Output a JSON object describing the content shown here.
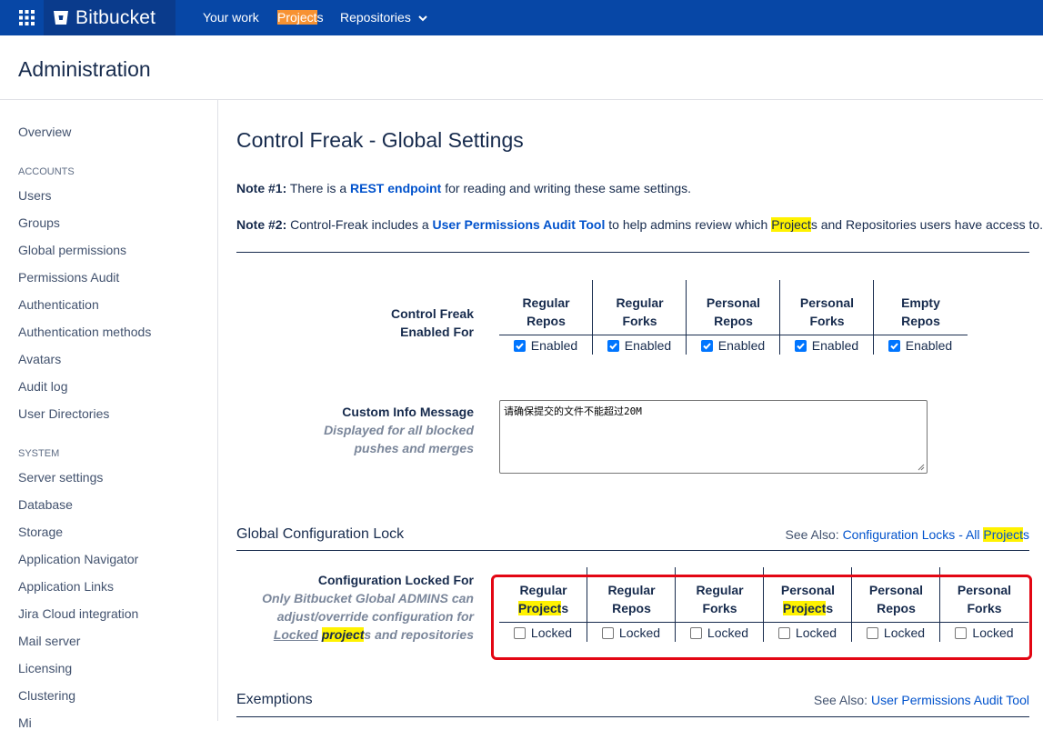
{
  "topbar": {
    "brand": "Bitbucket",
    "nav": [
      {
        "label": "Your work"
      },
      {
        "label_hl": "Project",
        "label_rest": "s"
      },
      {
        "label": "Repositories"
      }
    ]
  },
  "admin_title": "Administration",
  "sidebar": {
    "overview": "Overview",
    "accounts_heading": "ACCOUNTS",
    "accounts": [
      "Users",
      "Groups",
      "Global permissions",
      "Permissions Audit",
      "Authentication",
      "Authentication methods",
      "Avatars",
      "Audit log",
      "User Directories"
    ],
    "system_heading": "SYSTEM",
    "system": [
      "Server settings",
      "Database",
      "Storage",
      "Application Navigator",
      "Application Links",
      "Jira Cloud integration",
      "Mail server",
      "Licensing",
      "Clustering",
      "Mi"
    ]
  },
  "main": {
    "title": "Control Freak - Global Settings",
    "note1": {
      "label": "Note #1:",
      "pre": " There is a ",
      "link": "REST endpoint",
      "post": " for reading and writing these same settings."
    },
    "note2": {
      "label": "Note #2:",
      "pre": " Control-Freak includes a ",
      "link": "User Permissions Audit Tool",
      "mid": " to help admins review which ",
      "hl": "Project",
      "post": "s and Repositories users have access to."
    },
    "enabled_for": {
      "label_line1": "Control Freak",
      "label_line2": "Enabled For",
      "columns": [
        {
          "l1": "Regular",
          "l2": "Repos",
          "check": "Enabled",
          "checked": true
        },
        {
          "l1": "Regular",
          "l2": "Forks",
          "check": "Enabled",
          "checked": true
        },
        {
          "l1": "Personal",
          "l2": "Repos",
          "check": "Enabled",
          "checked": true
        },
        {
          "l1": "Personal",
          "l2": "Forks",
          "check": "Enabled",
          "checked": true
        },
        {
          "l1": "Empty",
          "l2": "Repos",
          "check": "Enabled",
          "checked": true
        }
      ]
    },
    "custom_info": {
      "label": "Custom Info Message",
      "desc1": "Displayed for all blocked",
      "desc2": "pushes and merges",
      "value": "请确保提交的文件不能超过20M"
    },
    "global_lock": {
      "heading": "Global Configuration Lock",
      "see_also": "See Also: ",
      "see_also_link": "Configuration Locks - All ",
      "see_also_hl": "Project",
      "see_also_tail": "s",
      "label": "Configuration Locked For",
      "desc1": "Only Bitbucket Global ADMINS can",
      "desc2": "adjust/override configuration for",
      "desc3_locked": "Locked",
      "desc3_hl": "project",
      "desc3_rest": "s and repositories",
      "columns": [
        {
          "l1": "Regular",
          "l2_hl": "Project",
          "l2_rest": "s",
          "check": "Locked",
          "checked": false
        },
        {
          "l1": "Regular",
          "l2": "Repos",
          "check": "Locked",
          "checked": false
        },
        {
          "l1": "Regular",
          "l2": "Forks",
          "check": "Locked",
          "checked": false
        },
        {
          "l1": "Personal",
          "l2_hl": "Project",
          "l2_rest": "s",
          "check": "Locked",
          "checked": false
        },
        {
          "l1": "Personal",
          "l2": "Repos",
          "check": "Locked",
          "checked": false
        },
        {
          "l1": "Personal",
          "l2": "Forks",
          "check": "Locked",
          "checked": false
        }
      ]
    },
    "exemptions": {
      "heading": "Exemptions",
      "see_also": "See Also: ",
      "see_also_link": "User Permissions Audit Tool"
    }
  },
  "colors": {
    "topbar": "#0747a6",
    "brand_bg": "#0a3b8c",
    "highlight_orange": "#f79232",
    "highlight_yellow": "#fff200",
    "link": "#0052cc",
    "annotation_box": "#e30613"
  }
}
